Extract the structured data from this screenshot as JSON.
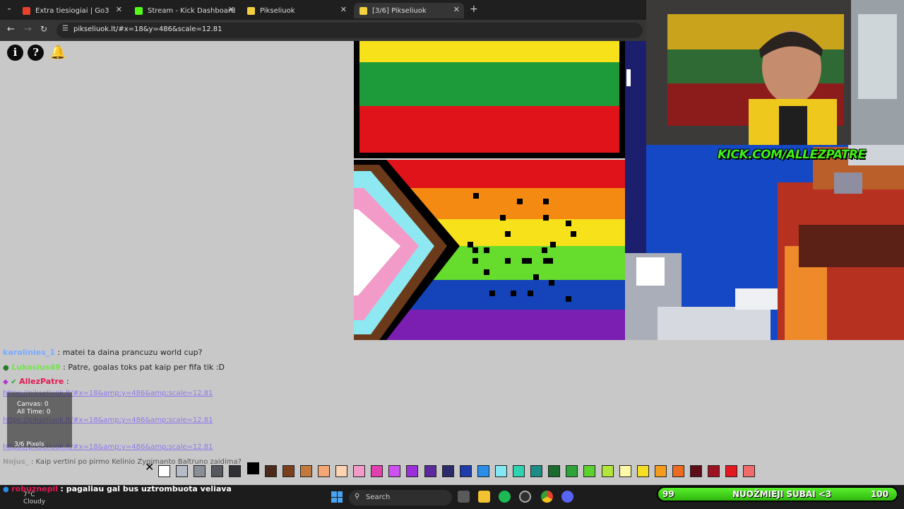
{
  "browser": {
    "tabs": [
      {
        "label": "Extra tiesiogiai | Go3",
        "favicon_color": "#e8422b"
      },
      {
        "label": "Stream - Kick Dashboard",
        "favicon_color": "#53fc18"
      },
      {
        "label": "Pikseliuok",
        "favicon_color": "#f4d03f"
      },
      {
        "label": "[3/6] Pikseliuok",
        "favicon_color": "#f4d03f"
      }
    ],
    "active_tab_index": 3,
    "url": "pikseliuok.lt/#x=18&y=486&scale=12.81"
  },
  "webcam": {
    "overlay_text": "KICK.COM/ALLEZPATRE"
  },
  "chat": {
    "messages": [
      {
        "user": "karolinies_1",
        "text": ": matei ta daina prancuzu world cup?",
        "user_color": "#7ba9ff"
      },
      {
        "user": "Lukosius49",
        "text": ": Patre, goalas toks pat kaip per fifa tik :D",
        "user_color": "#73e34b"
      },
      {
        "user": "AllezPatre",
        "text": ":",
        "user_color": "#e21a52"
      },
      {
        "user": "Nojus_",
        "text": ": Kaip vertini po pirmo Kelinio Zygimanto Baltruno zaidima?",
        "user_color": "#9c9c9c"
      },
      {
        "user": "robuznepil",
        "text": ": pagaliau gal bus uztrombuota veliava",
        "user_color": "#e21a52"
      }
    ],
    "links": [
      "https://pikseliuok.lt/#x=18&amp;y=486&amp;scale=12.81",
      "https://pikseliuok.lt/#x=18&amp;y=486&amp;scale=12.81",
      "https://pikseliuok.lt/#x=18&amp;y=486&amp;scale=12.81"
    ]
  },
  "stats": {
    "canvas_label": "Canvas: 0",
    "alltime_label": "All Time: 0",
    "pixels_label": "3/6 Pixels"
  },
  "palette": {
    "colors": [
      "#ffffff",
      "#b6bcc5",
      "#8a8f96",
      "#55595e",
      "#2f3135",
      "#000000",
      "#4b2a1c",
      "#7a3f1d",
      "#c17a3c",
      "#f2a774",
      "#fcd3b4",
      "#f29bc9",
      "#e23fae",
      "#d04ff2",
      "#9b2fd9",
      "#5a2a9e",
      "#2b2a6a",
      "#1d3ba9",
      "#2a8ee8",
      "#84e6f2",
      "#2fd3b1",
      "#1b8c86",
      "#1b6b2f",
      "#2ea338",
      "#5dd12f",
      "#b3e63b",
      "#fff9a8",
      "#f5de24",
      "#f59c1c",
      "#ee6a1e",
      "#5c0d17",
      "#9c1220",
      "#e21a20",
      "#f26b6b"
    ],
    "selected_index": 5
  },
  "taskbar": {
    "search_label": "Search",
    "weather_temp": "7°C",
    "weather_desc": "Cloudy"
  },
  "subgoal": {
    "current": "99",
    "label": "NUOŽMIEJI SUBAI <3",
    "target": "100"
  }
}
